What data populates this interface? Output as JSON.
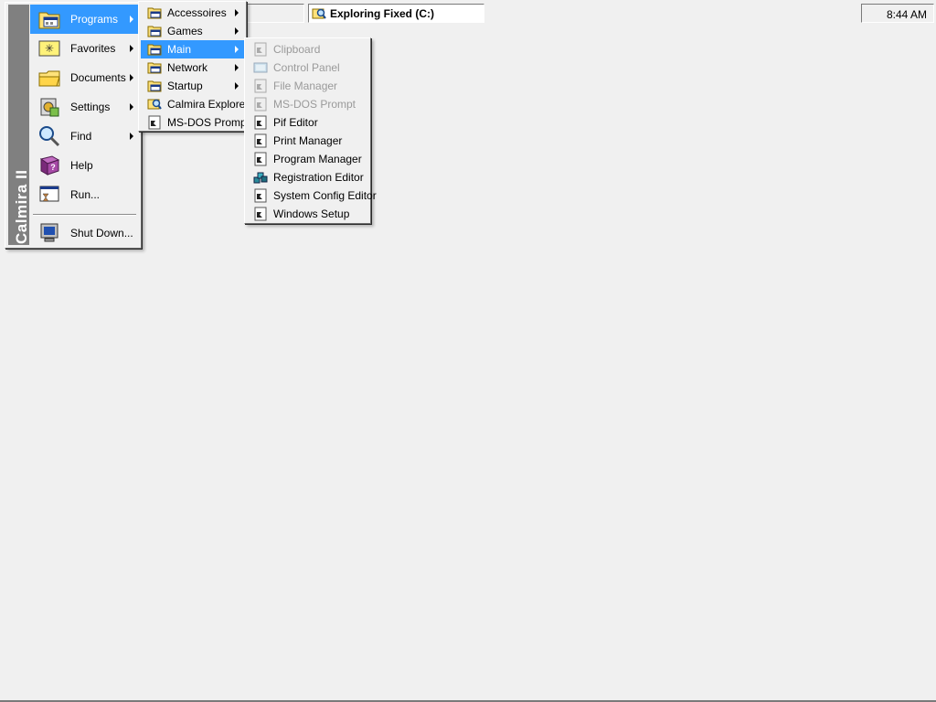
{
  "taskbar": {
    "explorer_window_label": "Exploring Fixed (C:)",
    "clock": "8:44 AM"
  },
  "start_menu": {
    "banner": "Calmira II",
    "items": [
      {
        "label": "Programs",
        "icon": "programs-folder-icon",
        "submenu": true,
        "selected": true
      },
      {
        "label": "Favorites",
        "icon": "favorites-icon",
        "submenu": true
      },
      {
        "label": "Documents",
        "icon": "documents-folder-icon",
        "submenu": true
      },
      {
        "label": "Settings",
        "icon": "settings-icon",
        "submenu": true
      },
      {
        "label": "Find",
        "icon": "find-icon",
        "submenu": true
      },
      {
        "label": "Help",
        "icon": "help-book-icon",
        "submenu": false
      },
      {
        "label": "Run...",
        "icon": "run-icon",
        "submenu": false
      },
      {
        "label": "Shut Down...",
        "icon": "shutdown-icon",
        "submenu": false
      }
    ]
  },
  "programs_menu": {
    "items": [
      {
        "label": "Accessoires",
        "submenu": true
      },
      {
        "label": "Games",
        "submenu": true
      },
      {
        "label": "Main",
        "submenu": true,
        "selected": true
      },
      {
        "label": "Network",
        "submenu": true
      },
      {
        "label": "Startup",
        "submenu": true
      },
      {
        "label": "Calmira Explorer",
        "submenu": false
      },
      {
        "label": "MS-DOS Prompt",
        "submenu": false
      }
    ]
  },
  "main_menu": {
    "items": [
      {
        "label": "Clipboard",
        "disabled": true
      },
      {
        "label": "Control Panel",
        "disabled": true
      },
      {
        "label": "File Manager",
        "disabled": true
      },
      {
        "label": "MS-DOS Prompt",
        "disabled": true
      },
      {
        "label": "Pif Editor",
        "disabled": false
      },
      {
        "label": "Print Manager",
        "disabled": false
      },
      {
        "label": "Program Manager",
        "disabled": false
      },
      {
        "label": "Registration Editor",
        "disabled": false
      },
      {
        "label": "System Config Editor",
        "disabled": false
      },
      {
        "label": "Windows Setup",
        "disabled": false
      }
    ]
  },
  "colors": {
    "desktop": "#f0f0f0",
    "selection": "#3399ff",
    "banner": "#808080",
    "disabled_text": "#9a9a9a"
  }
}
